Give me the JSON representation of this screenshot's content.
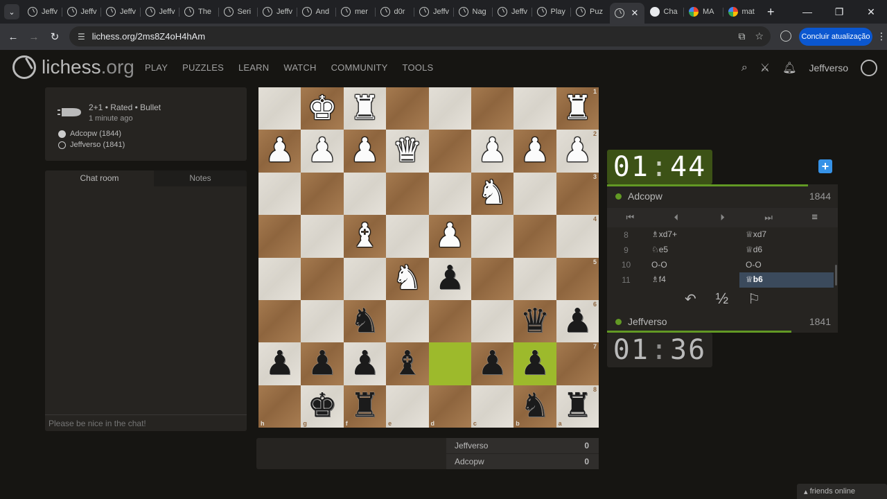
{
  "browser": {
    "tabs": [
      {
        "label": "Jeffv",
        "icon": "lichess"
      },
      {
        "label": "Jeffv",
        "icon": "lichess"
      },
      {
        "label": "Jeffv",
        "icon": "lichess"
      },
      {
        "label": "Jeffv",
        "icon": "lichess"
      },
      {
        "label": "The",
        "icon": "lichess"
      },
      {
        "label": "Seri",
        "icon": "lichess"
      },
      {
        "label": "Jeffv",
        "icon": "lichess"
      },
      {
        "label": "And",
        "icon": "lichess"
      },
      {
        "label": "mer",
        "icon": "lichess"
      },
      {
        "label": "d0r",
        "icon": "lichess"
      },
      {
        "label": "Jeffv",
        "icon": "lichess"
      },
      {
        "label": "Nag",
        "icon": "lichess"
      },
      {
        "label": "Jeffv",
        "icon": "lichess"
      },
      {
        "label": "Play",
        "icon": "lichess"
      },
      {
        "label": "Puz",
        "icon": "lichess"
      }
    ],
    "active_tab_icon": "lichess",
    "tabs_after": [
      {
        "label": "Cha",
        "icon": "chatgpt"
      },
      {
        "label": "MA",
        "icon": "google"
      },
      {
        "label": "mat",
        "icon": "google"
      }
    ],
    "url": "lichess.org/2ms8Z4oH4hAm",
    "update_button": "Concluir atualização"
  },
  "site": {
    "logo_main": "lichess",
    "logo_tld": ".org",
    "nav": [
      "PLAY",
      "PUZZLES",
      "LEARN",
      "WATCH",
      "COMMUNITY",
      "TOOLS"
    ],
    "username": "Jeffverso"
  },
  "game_meta": {
    "line1": "2+1 • Rated • Bullet",
    "line2": "1 minute ago",
    "white_player": "Adcopw (1844)",
    "black_player": "Jeffverso (1841)"
  },
  "chat": {
    "tab_chat": "Chat room",
    "tab_notes": "Notes",
    "placeholder": "Please be nice in the chat!"
  },
  "board": {
    "rank_labels": [
      "1",
      "2",
      "3",
      "4",
      "5",
      "6",
      "7",
      "8"
    ],
    "file_labels": [
      "h",
      "g",
      "f",
      "e",
      "d",
      "c",
      "b",
      "a"
    ],
    "highlight_squares": [
      "6-4",
      "6-6"
    ],
    "rows": [
      [
        "",
        "wK",
        "wR",
        "",
        "",
        "",
        "",
        "wR"
      ],
      [
        "wP",
        "wP",
        "wP",
        "wQ",
        "",
        "wP",
        "wP",
        "wP"
      ],
      [
        "",
        "",
        "",
        "",
        "",
        "wN",
        "",
        ""
      ],
      [
        "",
        "",
        "wB",
        "",
        "wP",
        "",
        "",
        ""
      ],
      [
        "",
        "",
        "",
        "wN",
        "bP",
        "",
        "",
        ""
      ],
      [
        "",
        "",
        "bN",
        "",
        "",
        "",
        "bQ",
        "bP"
      ],
      [
        "bP",
        "bP",
        "bP",
        "bB",
        "",
        "bP",
        "bP",
        ""
      ],
      [
        "",
        "bK",
        "bR",
        "",
        "",
        "",
        "bN",
        "bR"
      ]
    ]
  },
  "crosstable": [
    {
      "name": "Jeffverso",
      "score": "0"
    },
    {
      "name": "Adcopw",
      "score": "0"
    }
  ],
  "clocks": {
    "top": {
      "min": "01",
      "sec": "44"
    },
    "bottom": {
      "min": "01",
      "sec": "36"
    }
  },
  "players": {
    "top": {
      "name": "Adcopw",
      "rating": "1844",
      "time_remaining_fraction": 0.87
    },
    "bottom": {
      "name": "Jeffverso",
      "rating": "1841",
      "time_remaining_fraction": 0.8
    }
  },
  "moves": [
    {
      "num": "8",
      "white": "♗xd7+",
      "black": "♕xd7"
    },
    {
      "num": "9",
      "white": "♘e5",
      "black": "♕d6"
    },
    {
      "num": "10",
      "white": "O-O",
      "black": "O-O"
    },
    {
      "num": "11",
      "white": "♗f4",
      "black": "♕b6"
    }
  ],
  "friends": "friends online",
  "colors": {
    "accent_green": "#629924",
    "highlight": "#9dba2c",
    "update_blue": "#0b57d0",
    "plus_blue": "#3692e7"
  }
}
